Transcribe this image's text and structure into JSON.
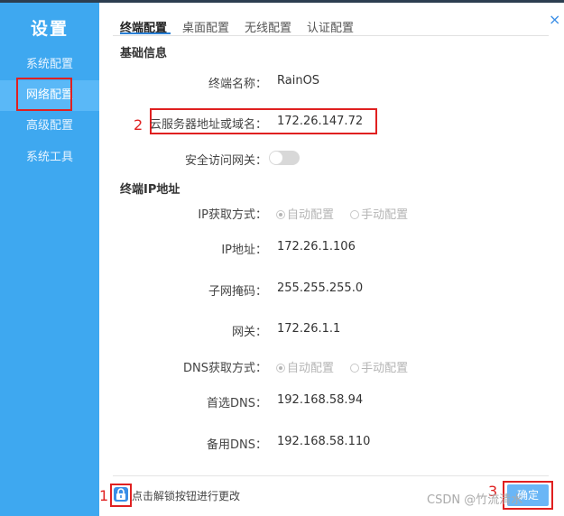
{
  "sidebar": {
    "title": "设置",
    "items": [
      {
        "label": "系统配置"
      },
      {
        "label": "网络配置"
      },
      {
        "label": "高级配置"
      },
      {
        "label": "系统工具"
      }
    ]
  },
  "tabs": [
    {
      "label": "终端配置"
    },
    {
      "label": "桌面配置"
    },
    {
      "label": "无线配置"
    },
    {
      "label": "认证配置"
    }
  ],
  "close_glyph": "×",
  "basic": {
    "title": "基础信息",
    "terminal_name_label": "终端名称：",
    "terminal_name_value": "RainOS",
    "cloud_server_label": "云服务器地址或域名：",
    "cloud_server_value": "172.26.147.72",
    "secure_gateway_label": "安全访问网关："
  },
  "ip": {
    "title": "终端IP地址",
    "ip_method_label": "IP获取方式：",
    "ip_method_options": [
      "自动配置",
      "手动配置"
    ],
    "ip_label": "IP地址：",
    "ip_value": "172.26.1.106",
    "mask_label": "子网掩码：",
    "mask_value": "255.255.255.0",
    "gateway_label": "网关：",
    "gateway_value": "172.26.1.1",
    "dns_method_label": "DNS获取方式：",
    "dns_method_options": [
      "自动配置",
      "手动配置"
    ],
    "dns1_label": "首选DNS：",
    "dns1_value": "192.168.58.94",
    "dns2_label": "备用DNS：",
    "dns2_value": "192.168.58.110"
  },
  "footer": {
    "unlock_text": "点击解锁按钮进行更改",
    "confirm_label": "确定"
  },
  "annotations": {
    "one": "1",
    "two": "2",
    "three": "3"
  },
  "watermark": "CSDN @竹流清水",
  "colors": {
    "sidebar": "#3ea8f0",
    "accent": "#2a7fd4",
    "annotation": "#e02020"
  }
}
